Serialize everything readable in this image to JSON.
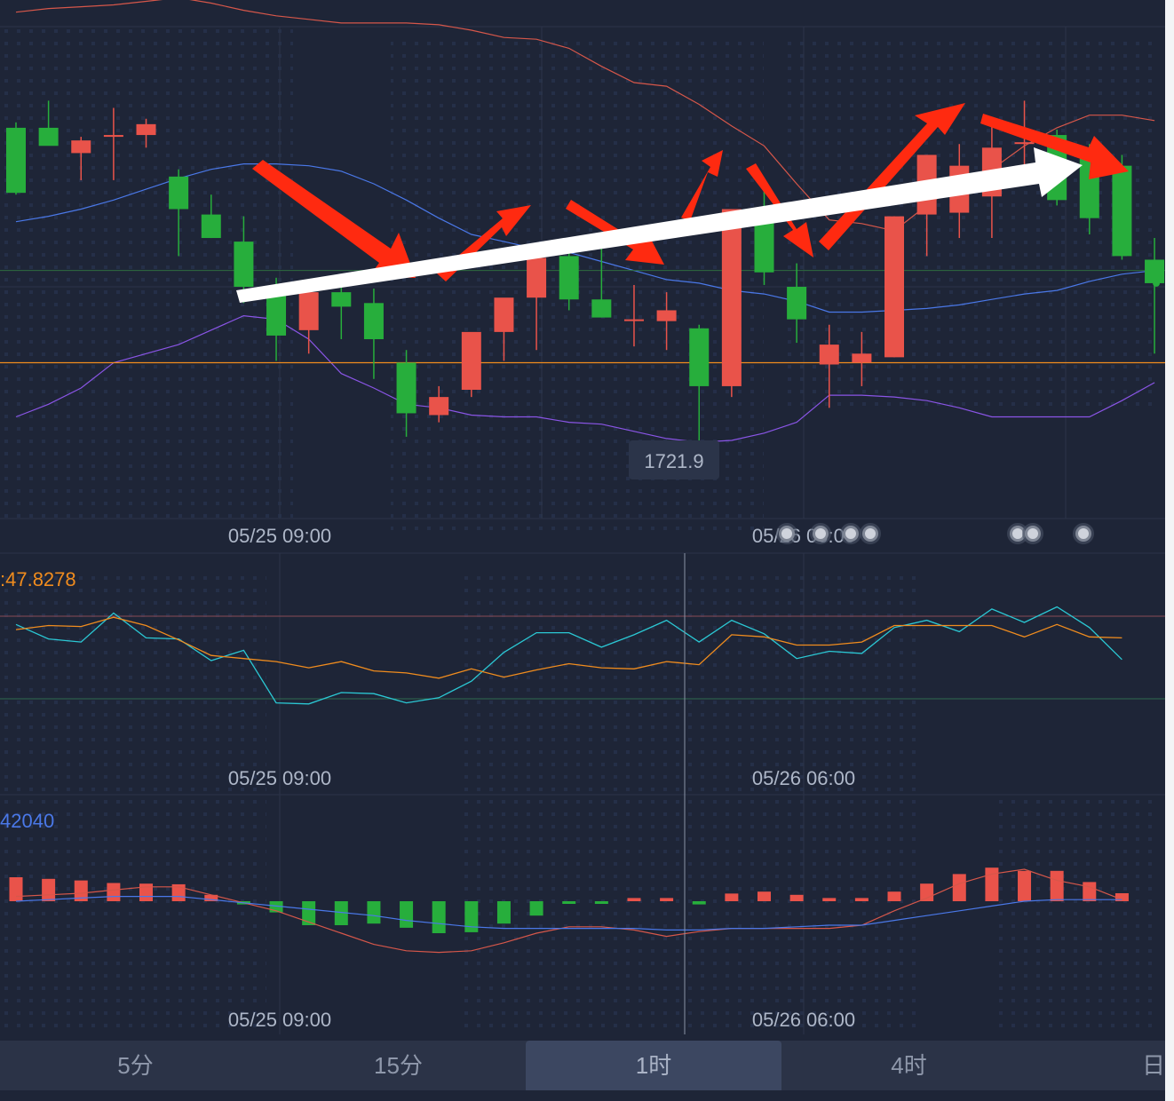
{
  "colors": {
    "background": "#1e2537",
    "up": "#e9534a",
    "down": "#27ae3c",
    "upper_band": "#d6574a",
    "middle_band": "#4a78e8",
    "lower_band": "#8a55e6",
    "price_line": "#f08c1e",
    "rsi_fast": "#2bc8d4",
    "rsi_slow": "#f08c1e",
    "macd_dif": "#d6574a",
    "macd_dea": "#4a78e8",
    "annotation_red": "#ff2a10",
    "annotation_white": "#ffffff"
  },
  "chart_data": [
    {
      "type": "candlestick",
      "panel": "main",
      "x_labels": [
        "05/25 09:00",
        "05/26 06:00"
      ],
      "candles": [
        {
          "o": 1810.5,
          "h": 1812.0,
          "l": 1792.0,
          "c": 1792.5
        },
        {
          "o": 1810.5,
          "h": 1818.0,
          "l": 1806.0,
          "c": 1805.5
        },
        {
          "o": 1803.5,
          "h": 1808.0,
          "l": 1796.0,
          "c": 1807.0
        },
        {
          "o": 1808.0,
          "h": 1816.0,
          "l": 1796.0,
          "c": 1808.5
        },
        {
          "o": 1808.5,
          "h": 1813.0,
          "l": 1805.0,
          "c": 1811.5
        },
        {
          "o": 1797.0,
          "h": 1799.0,
          "l": 1775.0,
          "c": 1788.0
        },
        {
          "o": 1786.5,
          "h": 1792.0,
          "l": 1780.0,
          "c": 1780.0
        },
        {
          "o": 1779.0,
          "h": 1786.0,
          "l": 1762.0,
          "c": 1766.5
        },
        {
          "o": 1765.0,
          "h": 1769.0,
          "l": 1746.0,
          "c": 1753.0
        },
        {
          "o": 1754.5,
          "h": 1756.0,
          "l": 1748.0,
          "c": 1765.0
        },
        {
          "o": 1765.0,
          "h": 1768.0,
          "l": 1752.0,
          "c": 1761.0
        },
        {
          "o": 1762.0,
          "h": 1766.0,
          "l": 1741.0,
          "c": 1752.0
        },
        {
          "o": 1745.5,
          "h": 1749.0,
          "l": 1725.0,
          "c": 1731.5
        },
        {
          "o": 1731.0,
          "h": 1739.0,
          "l": 1729.0,
          "c": 1736.0
        },
        {
          "o": 1738.0,
          "h": 1753.0,
          "l": 1736.0,
          "c": 1754.0
        },
        {
          "o": 1754.0,
          "h": 1762.0,
          "l": 1746.0,
          "c": 1763.5
        },
        {
          "o": 1763.5,
          "h": 1777.0,
          "l": 1749.0,
          "c": 1774.5
        },
        {
          "o": 1775.0,
          "h": 1777.0,
          "l": 1760.0,
          "c": 1763.0
        },
        {
          "o": 1763.0,
          "h": 1778.0,
          "l": 1758.0,
          "c": 1758.0
        },
        {
          "o": 1757.5,
          "h": 1767.0,
          "l": 1750.0,
          "c": 1757.5
        },
        {
          "o": 1757.0,
          "h": 1765.0,
          "l": 1749.0,
          "c": 1760.0
        },
        {
          "o": 1755.0,
          "h": 1756.0,
          "l": 1721.9,
          "c": 1739.0
        },
        {
          "o": 1739.0,
          "h": 1788.0,
          "l": 1736.0,
          "c": 1788.0
        },
        {
          "o": 1786.5,
          "h": 1794.0,
          "l": 1767.0,
          "c": 1770.5
        },
        {
          "o": 1766.5,
          "h": 1773.0,
          "l": 1751.0,
          "c": 1757.5
        },
        {
          "o": 1745.0,
          "h": 1756.0,
          "l": 1733.0,
          "c": 1750.5
        },
        {
          "o": 1745.5,
          "h": 1754.0,
          "l": 1739.0,
          "c": 1748.0
        },
        {
          "o": 1747.0,
          "h": 1786.0,
          "l": 1747.0,
          "c": 1786.0
        },
        {
          "o": 1786.5,
          "h": 1803.0,
          "l": 1775.0,
          "c": 1803.0
        },
        {
          "o": 1787.0,
          "h": 1806.0,
          "l": 1780.0,
          "c": 1800.0
        },
        {
          "o": 1791.5,
          "h": 1813.0,
          "l": 1780.0,
          "c": 1805.0
        },
        {
          "o": 1806.5,
          "h": 1818.0,
          "l": 1797.0,
          "c": 1806.5
        },
        {
          "o": 1808.5,
          "h": 1810.0,
          "l": 1789.0,
          "c": 1790.5
        },
        {
          "o": 1803.0,
          "h": 1806.0,
          "l": 1781.0,
          "c": 1785.5
        },
        {
          "o": 1800.0,
          "h": 1803.0,
          "l": 1774.0,
          "c": 1775.0
        },
        {
          "o": 1774.0,
          "h": 1780.0,
          "l": 1748.0,
          "c": 1767.5
        }
      ],
      "bands": {
        "upper": [
          1842.5,
          1843.5,
          1844.0,
          1844.5,
          1845.5,
          1846.5,
          1845.0,
          1843.0,
          1841.5,
          1840.5,
          1839.5,
          1839.5,
          1839.5,
          1839.0,
          1837.5,
          1835.5,
          1835.0,
          1832.5,
          1827.5,
          1823.0,
          1822.0,
          1817.0,
          1811.0,
          1805.5,
          1795.0,
          1785.0,
          1784.0,
          1782.0,
          1789.0,
          1795.0,
          1799.0,
          1805.5,
          1810.5,
          1814.0,
          1814.0,
          1812.5
        ],
        "middle": [
          1784.5,
          1786.0,
          1788.0,
          1790.5,
          1793.5,
          1796.5,
          1799.0,
          1800.5,
          1800.5,
          1800.0,
          1798.5,
          1795.0,
          1790.5,
          1785.5,
          1781.0,
          1779.0,
          1777.0,
          1776.0,
          1773.5,
          1771.0,
          1768.5,
          1767.5,
          1765.5,
          1764.5,
          1762.5,
          1759.5,
          1759.5,
          1760.0,
          1760.5,
          1761.5,
          1763.0,
          1764.5,
          1765.5,
          1768.0,
          1770.0,
          1771.0
        ],
        "lower": [
          1730.5,
          1734.0,
          1738.5,
          1745.5,
          1748.0,
          1750.5,
          1754.5,
          1758.5,
          1757.5,
          1752.0,
          1742.5,
          1738.5,
          1734.0,
          1733.0,
          1731.0,
          1730.5,
          1730.5,
          1729.0,
          1728.5,
          1726.5,
          1724.5,
          1723.5,
          1724.0,
          1726.0,
          1729.0,
          1736.5,
          1736.5,
          1736.0,
          1735.0,
          1733.0,
          1730.5,
          1730.5,
          1730.5,
          1730.5,
          1735.0,
          1740.0
        ]
      },
      "price_line": 1745.5,
      "low_marker": {
        "index": 21,
        "value": "1721.9"
      }
    },
    {
      "type": "line",
      "panel": "rsi",
      "label": ":47.8278",
      "x_labels": [
        "05/25 09:00",
        "05/26 06:00"
      ],
      "ref_lines": [
        70,
        30
      ],
      "series": [
        {
          "values": [
            66.0,
            59.0,
            57.5,
            71.5,
            59.5,
            59.0,
            48.5,
            53.5,
            28.0,
            27.5,
            33.0,
            32.5,
            28.0,
            30.5,
            38.5,
            52.5,
            62.0,
            62.0,
            55.0,
            61.0,
            68.0,
            57.5,
            68.0,
            61.5,
            49.5,
            53.0,
            52.0,
            64.5,
            68.0,
            62.5,
            73.5,
            67.0,
            74.5,
            64.5,
            49.0
          ]
        },
        {
          "values": [
            63.5,
            65.5,
            65.0,
            69.5,
            65.5,
            58.5,
            51.0,
            49.5,
            48.0,
            45.0,
            48.0,
            43.5,
            42.5,
            40.0,
            44.5,
            40.5,
            44.0,
            47.0,
            45.0,
            44.5,
            48.0,
            46.5,
            61.0,
            60.0,
            56.0,
            56.0,
            57.5,
            65.5,
            65.5,
            65.5,
            65.5,
            60.0,
            66.0,
            60.0,
            59.5
          ]
        }
      ]
    },
    {
      "type": "bar",
      "panel": "macd",
      "label": "42040",
      "x_labels": [
        "05/25 09:00",
        "05/26 06:00"
      ],
      "histogram": [
        7.5,
        7.0,
        6.5,
        5.7,
        5.5,
        5.3,
        2.0,
        -1.0,
        -3.5,
        -7.5,
        -7.5,
        -7.0,
        -8.3,
        -10.0,
        -9.7,
        -7.0,
        -4.5,
        -0.7,
        -0.7,
        1.0,
        1.0,
        -1.0,
        2.4,
        3.0,
        2.0,
        1.0,
        1.0,
        3.0,
        5.5,
        8.5,
        10.5,
        9.5,
        9.5,
        6.0,
        2.5
      ],
      "dif": [
        1.5,
        2.0,
        2.5,
        3.5,
        4.5,
        4.5,
        2.0,
        -0.5,
        -3.0,
        -6.5,
        -10.0,
        -13.5,
        -15.5,
        -16.0,
        -15.5,
        -13.0,
        -10.0,
        -8.0,
        -8.0,
        -9.0,
        -11.0,
        -9.5,
        -8.5,
        -8.5,
        -8.5,
        -8.5,
        -7.5,
        -3.0,
        1.0,
        5.5,
        8.5,
        10.0,
        6.5,
        4.5,
        0.5
      ],
      "dea": [
        0.0,
        0.5,
        1.0,
        1.5,
        1.5,
        1.5,
        0.5,
        -0.5,
        -1.5,
        -2.5,
        -3.5,
        -4.5,
        -6.0,
        -7.0,
        -8.0,
        -8.5,
        -8.5,
        -8.5,
        -8.5,
        -8.5,
        -9.0,
        -9.0,
        -8.5,
        -8.5,
        -8.0,
        -7.5,
        -7.5,
        -6.0,
        -4.5,
        -3.0,
        -1.5,
        0.0,
        0.5,
        0.5,
        0.5
      ]
    }
  ],
  "timeframes": [
    "5分",
    "15分",
    "1时",
    "4时",
    "日"
  ],
  "active_timeframe": "1时"
}
